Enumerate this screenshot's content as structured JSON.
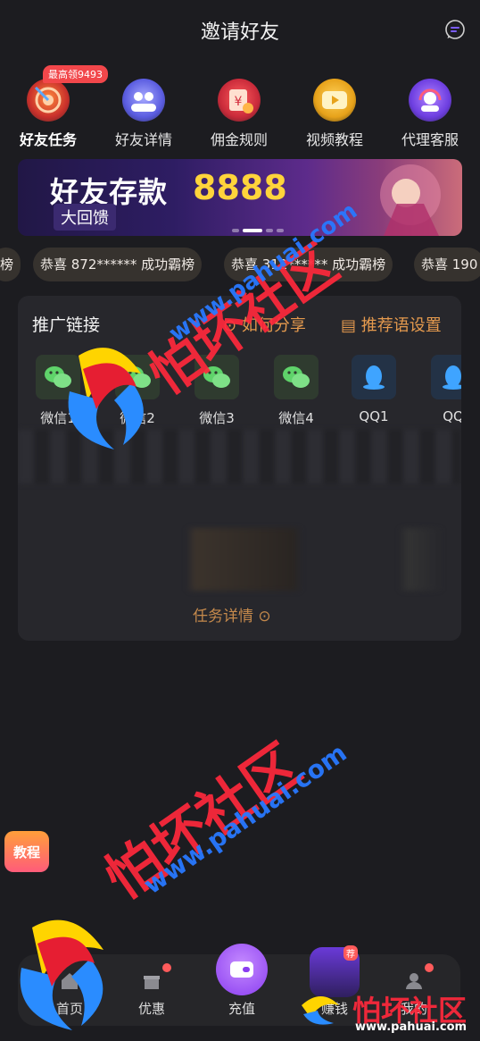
{
  "header": {
    "title": "邀请好友",
    "message_icon": "chat-bubble-icon"
  },
  "tabs": [
    {
      "label": "好友任务",
      "icon": "target-icon",
      "active": true,
      "badge": "最高领9493"
    },
    {
      "label": "好友详情",
      "icon": "friends-icon"
    },
    {
      "label": "佣金规则",
      "icon": "money-bag-icon"
    },
    {
      "label": "视频教程",
      "icon": "video-icon"
    },
    {
      "label": "代理客服",
      "icon": "support-agent-icon"
    }
  ],
  "banner": {
    "title": "好友存款",
    "amount": "8888",
    "subtitle": "大回馈"
  },
  "ticker": [
    "榜",
    "恭喜 872****** 成功霸榜",
    "恭喜 312****** 成功霸榜",
    "恭喜 190"
  ],
  "promo": {
    "title": "推广链接",
    "how_to_share": "如何分享",
    "phrase_settings": "推荐语设置",
    "share_items": [
      {
        "label": "微信1",
        "icon": "wechat-icon"
      },
      {
        "label": "微信2",
        "icon": "wechat-icon"
      },
      {
        "label": "微信3",
        "icon": "wechat-icon"
      },
      {
        "label": "微信4",
        "icon": "wechat-icon"
      },
      {
        "label": "QQ1",
        "icon": "qq-icon"
      },
      {
        "label": "QQ",
        "icon": "qq-icon"
      }
    ],
    "task_detail": "任务详情"
  },
  "side_button": {
    "label": "教程"
  },
  "bottom_nav": [
    {
      "label": "首页",
      "icon": "home-icon"
    },
    {
      "label": "优惠",
      "icon": "gift-icon"
    },
    {
      "label": "充值",
      "icon": "wallet-icon"
    },
    {
      "label": "赚钱",
      "icon": "money-bag-icon",
      "badge": "荐"
    },
    {
      "label": "我的",
      "icon": "user-icon"
    }
  ],
  "watermarks": {
    "brand": "怕坏社区",
    "url": "www.pahuai.com"
  },
  "colors": {
    "background": "#1c1c20",
    "accent": "#e59a4e",
    "badge": "#f2474b",
    "amount": "#ffd43b"
  }
}
